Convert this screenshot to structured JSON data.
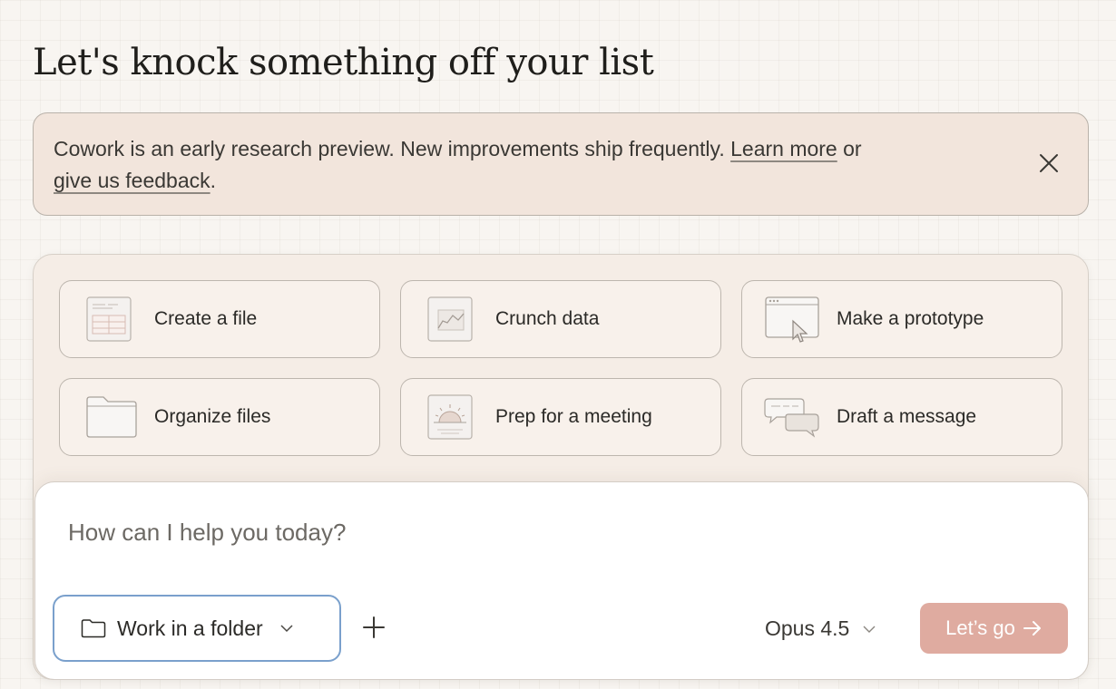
{
  "header": {
    "title": "Let's knock something off your list"
  },
  "banner": {
    "text_before": "Cowork is an early research preview. New improvements ship frequently.",
    "learn_more": "Learn more",
    "or": "or",
    "feedback": "give us feedback",
    "period": ".",
    "close_icon": "close-icon"
  },
  "tasks": [
    {
      "label": "Create a file",
      "icon": "document-icon"
    },
    {
      "label": "Crunch data",
      "icon": "chart-icon"
    },
    {
      "label": "Make a prototype",
      "icon": "browser-cursor-icon"
    },
    {
      "label": "Organize files",
      "icon": "folder-icon"
    },
    {
      "label": "Prep for a meeting",
      "icon": "sunrise-icon"
    },
    {
      "label": "Draft a message",
      "icon": "chat-bubbles-icon"
    }
  ],
  "composer": {
    "placeholder": "How can I help you today?",
    "folder_button": "Work in a folder",
    "model": "Opus 4.5",
    "submit": "Let’s go",
    "submit_color": "#dfaba0"
  }
}
